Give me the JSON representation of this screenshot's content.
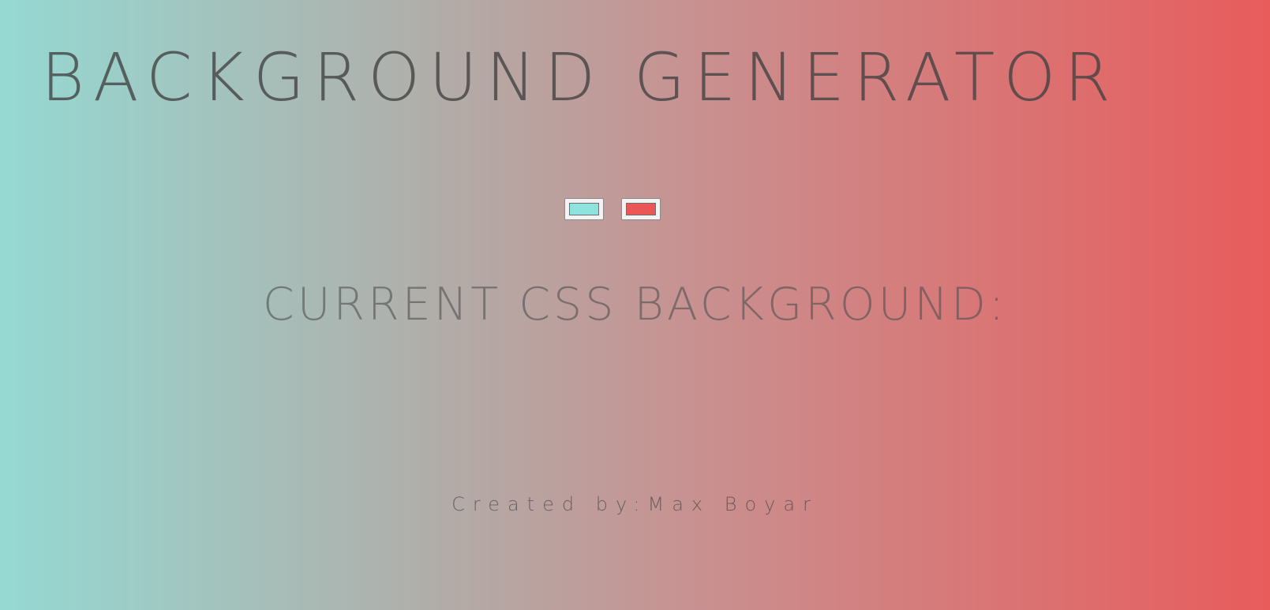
{
  "header": {
    "title": "BACKGROUND GENERATOR"
  },
  "pickers": {
    "color1": "#8ee3df",
    "color2": "#eb5757"
  },
  "main": {
    "subtitle": "CURRENT CSS BACKGROUND:",
    "css_value": ""
  },
  "footer": {
    "credit": "Created by:Max Boyar"
  },
  "theme": {
    "gradient_start": "#95d9d3",
    "gradient_end": "#e85c5c",
    "text_color": "#5b5b5b"
  }
}
